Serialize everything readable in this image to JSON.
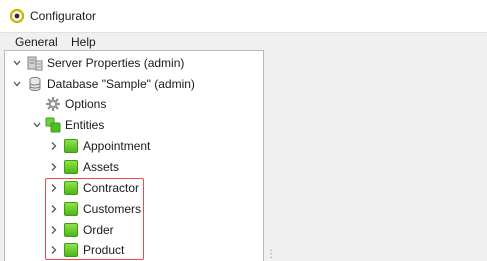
{
  "window": {
    "title": "Configurator",
    "app_icon": "configurator-logo-icon"
  },
  "menu": {
    "items": [
      "General",
      "Help"
    ]
  },
  "tree": {
    "server": {
      "label": "Server Properties (admin)",
      "icon": "server-icon",
      "expanded": true
    },
    "database": {
      "label": "Database \"Sample\" (admin)",
      "icon": "database-icon",
      "expanded": true
    },
    "options": {
      "label": "Options",
      "icon": "gear-icon"
    },
    "entities": {
      "label": "Entities",
      "icon": "entities-icon",
      "expanded": true
    },
    "entity_items": [
      "Appointment",
      "Assets",
      "Contractor",
      "Customers",
      "Order",
      "Product"
    ]
  },
  "colors": {
    "highlight": "#e34d4d",
    "entity_green": "#5cc524",
    "accent_yellow": "#c8b400"
  }
}
